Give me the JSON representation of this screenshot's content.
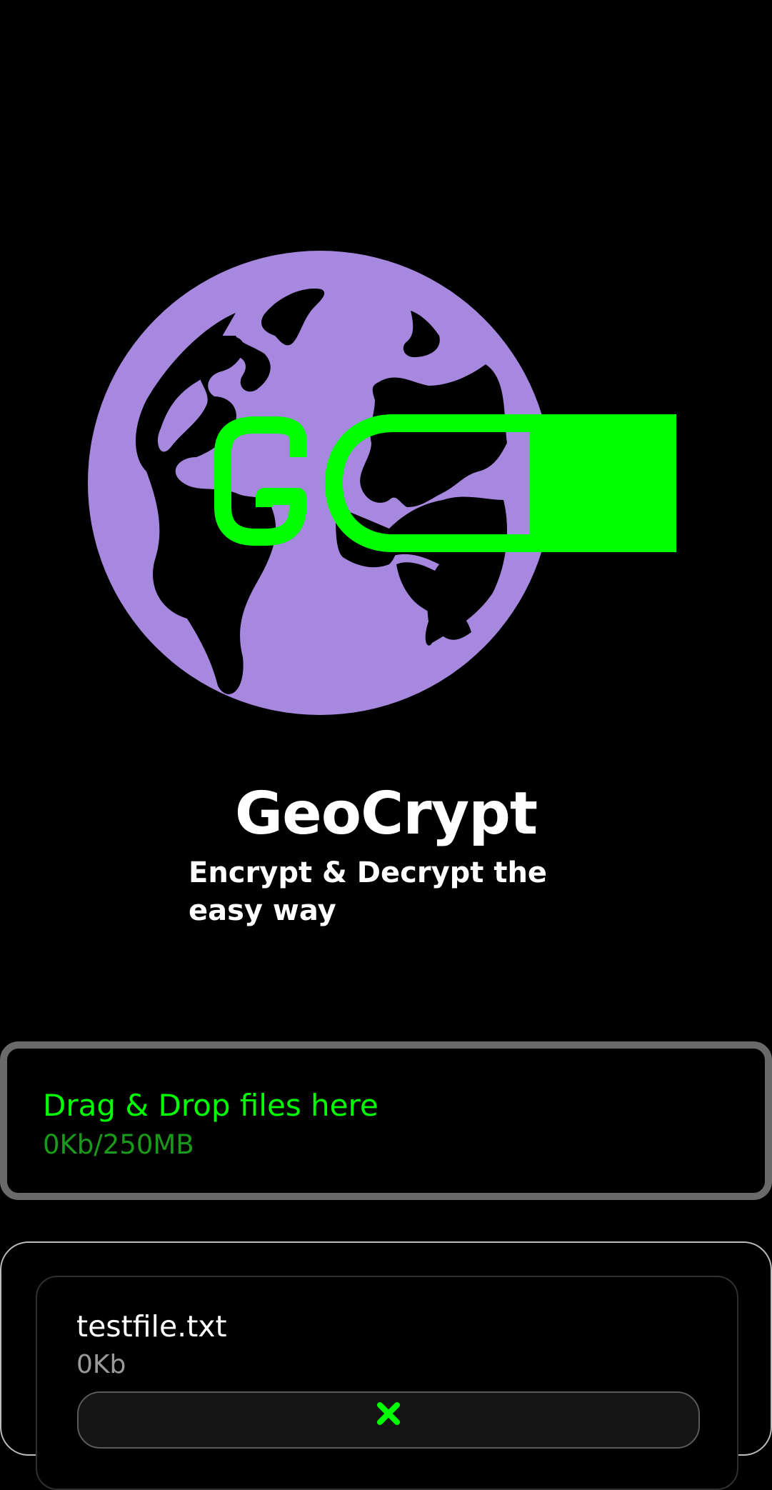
{
  "app": {
    "title": "GeoCrypt",
    "tagline": "Encrypt & Decrypt the easy way",
    "logo_letters": "GC"
  },
  "colors": {
    "background": "#000000",
    "accent_green": "#00ff00",
    "globe_purple": "#a688df",
    "dim_green": "#1a9a1a"
  },
  "dropzone": {
    "label": "Drag & Drop files here",
    "usage": "0Kb/250MB"
  },
  "files": [
    {
      "name": "testfile.txt",
      "size": "0Kb",
      "remove_icon": "close-x-icon"
    }
  ]
}
